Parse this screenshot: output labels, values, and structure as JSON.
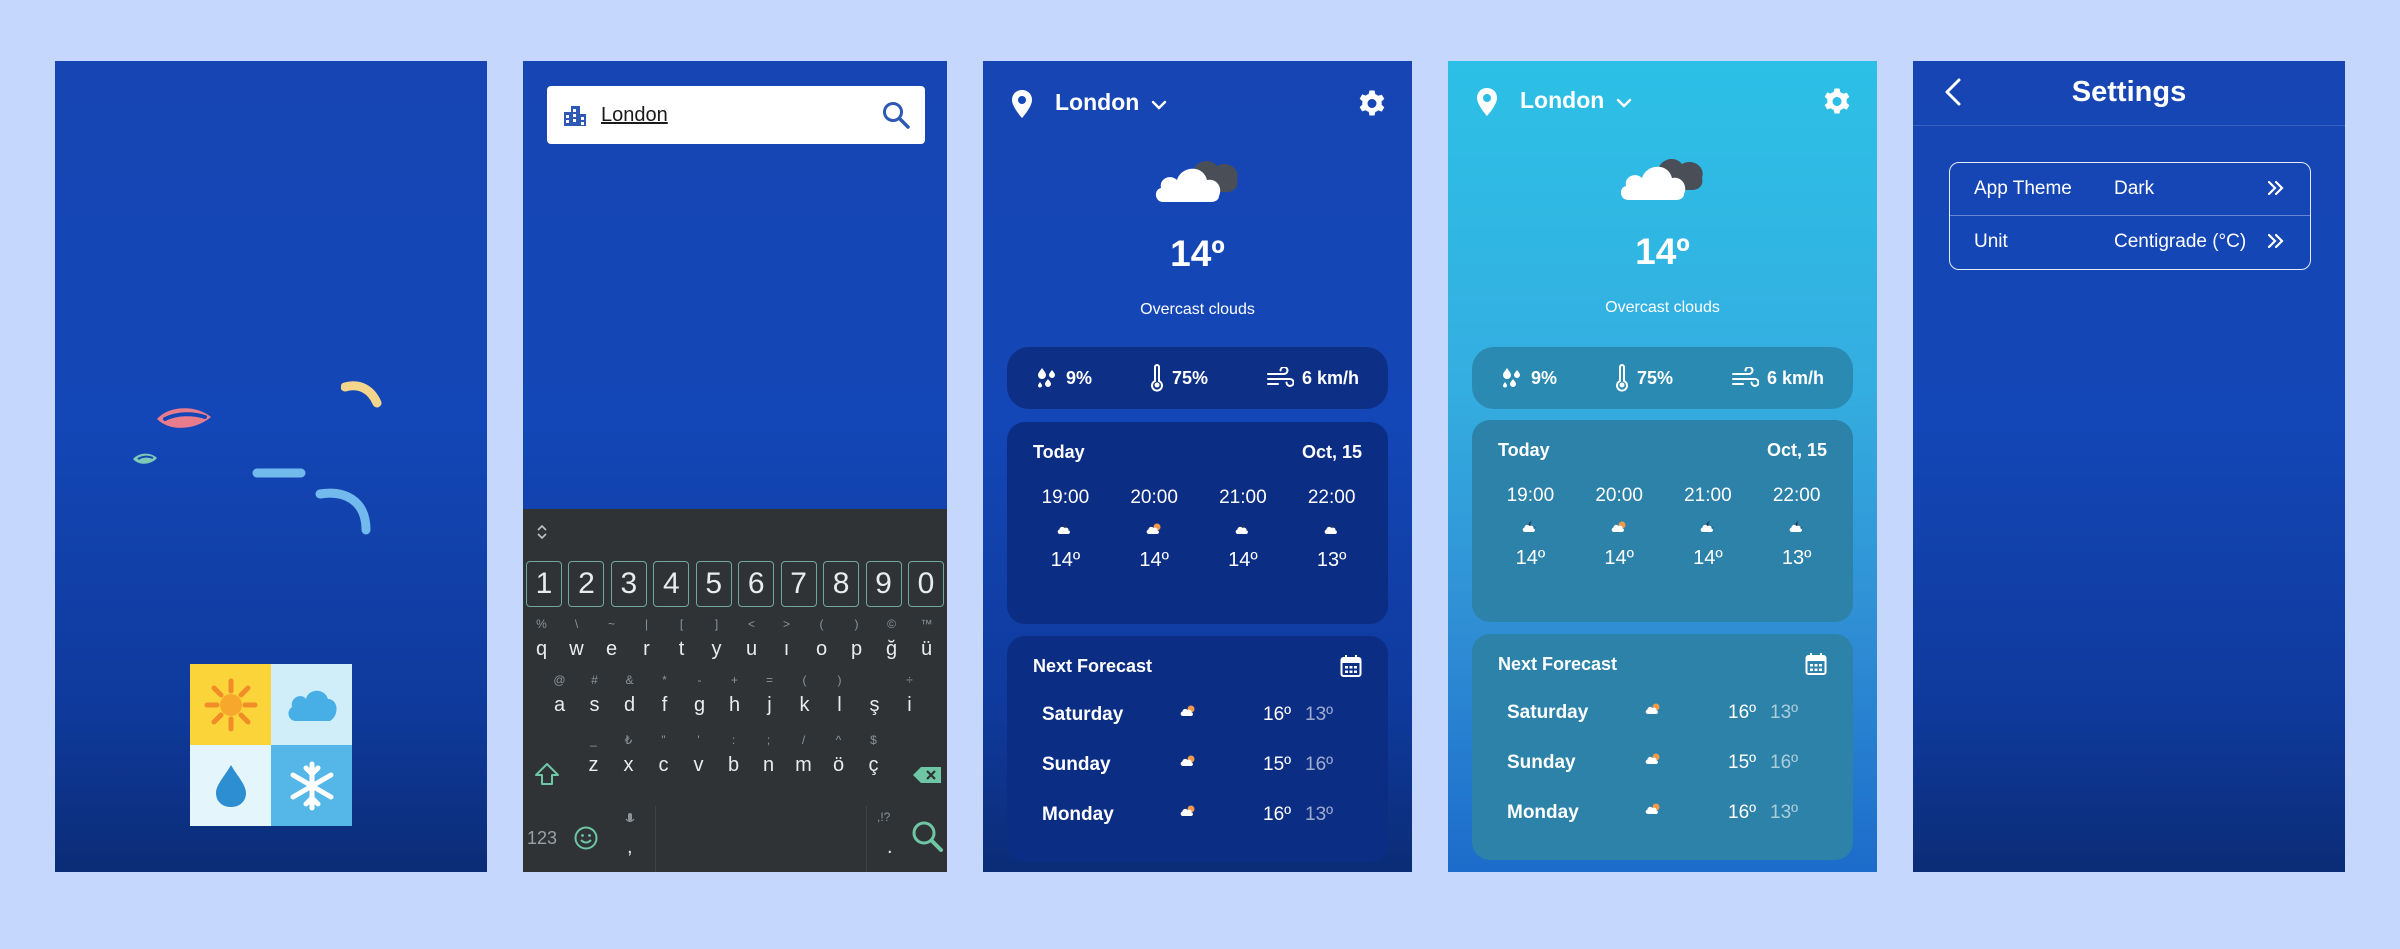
{
  "colors": {
    "page_background": "#c6d7fd",
    "dark_blue": "#1346b6",
    "stats_dark": "#0e2f86",
    "stats_light": "#2b8ab2",
    "card_dark": "#0c2d84",
    "card_light": "#2c82a8",
    "keyboard_bg": "#2f3336",
    "keyboard_accent": "#6fa89c"
  },
  "search_screen": {
    "input_value": "London",
    "search_icon": "search-icon",
    "city_icon": "city-buildings-icon",
    "keyboard": {
      "number_row": [
        "1",
        "2",
        "3",
        "4",
        "5",
        "6",
        "7",
        "8",
        "9",
        "0"
      ],
      "row1": [
        {
          "alt": "%",
          "main": "q"
        },
        {
          "alt": "\\",
          "main": "w"
        },
        {
          "alt": "~",
          "main": "e"
        },
        {
          "alt": "|",
          "main": "r"
        },
        {
          "alt": "[",
          "main": "t"
        },
        {
          "alt": "]",
          "main": "y"
        },
        {
          "alt": "<",
          "main": "u"
        },
        {
          "alt": ">",
          "main": "ı"
        },
        {
          "alt": "(",
          "main": "o"
        },
        {
          "alt": ")",
          "main": "p"
        },
        {
          "alt": "©",
          "main": "ğ"
        },
        {
          "alt": "™",
          "main": "ü"
        }
      ],
      "row2": [
        {
          "alt": "@",
          "main": "a"
        },
        {
          "alt": "#",
          "main": "s"
        },
        {
          "alt": "&",
          "main": "d"
        },
        {
          "alt": "*",
          "main": "f"
        },
        {
          "alt": "-",
          "main": "g"
        },
        {
          "alt": "+",
          "main": "h"
        },
        {
          "alt": "=",
          "main": "j"
        },
        {
          "alt": "(",
          "main": "k"
        },
        {
          "alt": ")",
          "main": "l"
        },
        {
          "alt": "",
          "main": "ş"
        },
        {
          "alt": "÷",
          "main": "i"
        }
      ],
      "row3": [
        {
          "alt": "_",
          "main": "z"
        },
        {
          "alt": "₺",
          "main": "x"
        },
        {
          "alt": "\"",
          "main": "c"
        },
        {
          "alt": "'",
          "main": "v"
        },
        {
          "alt": ":",
          "main": "b"
        },
        {
          "alt": ";",
          "main": "n"
        },
        {
          "alt": "/",
          "main": "m"
        },
        {
          "alt": "^",
          "main": "ö"
        },
        {
          "alt": "$",
          "main": "ç"
        }
      ],
      "mode_key": "123",
      "comma_key": ",",
      "period_key": ".",
      "period_alt": ",!?"
    }
  },
  "weather_dark": {
    "city": "London",
    "temperature": "14º",
    "condition": "Overcast clouds",
    "stats": {
      "precipitation": "9%",
      "humidity": "75%",
      "wind": "6 km/h"
    },
    "today": {
      "title": "Today",
      "date": "Oct, 15",
      "hours": [
        {
          "time": "19:00",
          "temp": "14º",
          "icon": "moon-cloud-icon"
        },
        {
          "time": "20:00",
          "temp": "14º",
          "icon": "sun-cloud-icon"
        },
        {
          "time": "21:00",
          "temp": "14º",
          "icon": "moon-cloud-icon"
        },
        {
          "time": "22:00",
          "temp": "13º",
          "icon": "moon-cloud-icon"
        }
      ]
    },
    "forecast": {
      "title": "Next Forecast",
      "days": [
        {
          "day": "Saturday",
          "hi": "16º",
          "lo": "13º"
        },
        {
          "day": "Sunday",
          "hi": "15º",
          "lo": "16º"
        },
        {
          "day": "Monday",
          "hi": "16º",
          "lo": "13º"
        }
      ]
    }
  },
  "weather_light": {
    "city": "London",
    "temperature": "14º",
    "condition": "Overcast clouds",
    "stats": {
      "precipitation": "9%",
      "humidity": "75%",
      "wind": "6 km/h"
    },
    "today": {
      "title": "Today",
      "date": "Oct, 15",
      "hours": [
        {
          "time": "19:00",
          "temp": "14º",
          "icon": "moon-cloud-icon"
        },
        {
          "time": "20:00",
          "temp": "14º",
          "icon": "sun-cloud-icon"
        },
        {
          "time": "21:00",
          "temp": "14º",
          "icon": "moon-cloud-icon"
        },
        {
          "time": "22:00",
          "temp": "13º",
          "icon": "moon-cloud-icon"
        }
      ]
    },
    "forecast": {
      "title": "Next Forecast",
      "days": [
        {
          "day": "Saturday",
          "hi": "16º",
          "lo": "13º"
        },
        {
          "day": "Sunday",
          "hi": "15º",
          "lo": "16º"
        },
        {
          "day": "Monday",
          "hi": "16º",
          "lo": "13º"
        }
      ]
    }
  },
  "settings": {
    "title": "Settings",
    "rows": [
      {
        "label": "App Theme",
        "value": "Dark"
      },
      {
        "label": "Unit",
        "value": "Centigrade (°C)"
      }
    ]
  }
}
